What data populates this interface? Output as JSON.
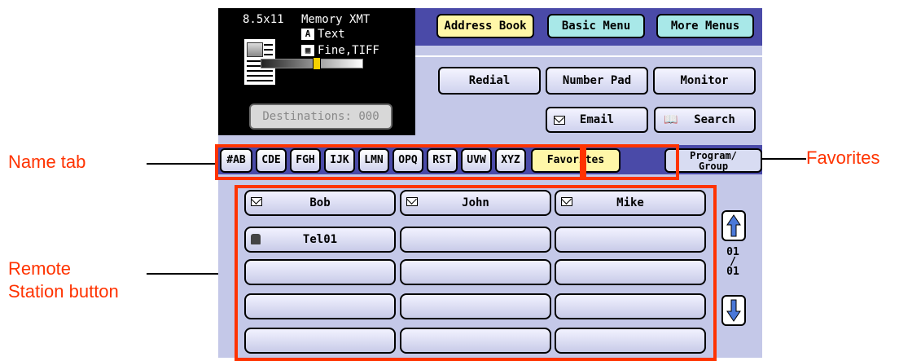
{
  "status": {
    "paper_size": "8.5x11",
    "mode": "Memory XMT",
    "original_type": "Text",
    "resolution": "Fine,TIFF",
    "destinations_label": "Destinations: 000"
  },
  "menu": {
    "address_book": "Address Book",
    "basic_menu": "Basic Menu",
    "more_menus": "More Menus",
    "redial": "Redial",
    "number_pad": "Number Pad",
    "monitor": "Monitor",
    "email": "Email",
    "search": "Search"
  },
  "tabs": [
    "#AB",
    "CDE",
    "FGH",
    "IJK",
    "LMN",
    "OPQ",
    "RST",
    "UVW",
    "XYZ",
    "Favorites"
  ],
  "program_group": {
    "line1": "Program/",
    "line2": "Group"
  },
  "stations": [
    {
      "label": "Bob",
      "icon": "email-icon"
    },
    {
      "label": "John",
      "icon": "email-icon"
    },
    {
      "label": "Mike",
      "icon": "email-icon"
    },
    {
      "label": "Tel01",
      "icon": "phone-icon"
    },
    {
      "label": "",
      "icon": ""
    },
    {
      "label": "",
      "icon": ""
    },
    {
      "label": "",
      "icon": ""
    },
    {
      "label": "",
      "icon": ""
    },
    {
      "label": "",
      "icon": ""
    },
    {
      "label": "",
      "icon": ""
    },
    {
      "label": "",
      "icon": ""
    },
    {
      "label": "",
      "icon": ""
    },
    {
      "label": "",
      "icon": ""
    },
    {
      "label": "",
      "icon": ""
    },
    {
      "label": "",
      "icon": ""
    }
  ],
  "page": {
    "current": "01",
    "divider": "/",
    "total": "01"
  },
  "callouts": {
    "name_tab": "Name tab",
    "favorites": "Favorites",
    "remote_station_line1": "Remote",
    "remote_station_line2": "Station button"
  },
  "colors": {
    "annotation": "#ff3300",
    "panel": "#c4c8e8",
    "highlight": "#fff7a8"
  }
}
